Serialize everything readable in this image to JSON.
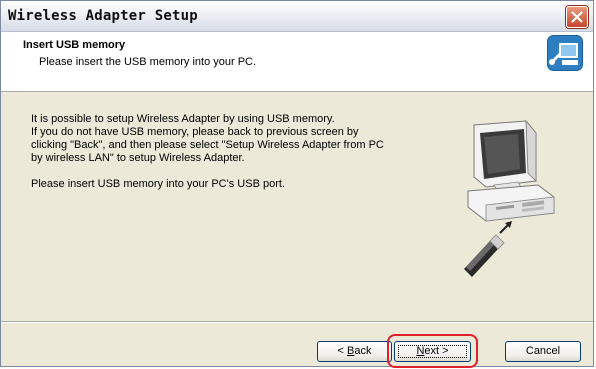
{
  "window": {
    "title": "Wireless Adapter Setup"
  },
  "header": {
    "title": "Insert USB memory",
    "subtitle": "Please insert the USB memory into your PC.",
    "icon": "computer-setup-icon"
  },
  "body": {
    "lines": [
      "It is possible to setup Wireless Adapter by using USB memory.",
      "If you do not have USB memory, please back to previous screen by",
      "clicking \"Back\", and then please select \"Setup Wireless Adapter from PC",
      "by wireless LAN\" to setup Wireless Adapter."
    ],
    "instruction": "Please insert USB memory into your PC's USB port."
  },
  "buttons": {
    "back_prefix": "< ",
    "back_mnemonic": "B",
    "back_rest": "ack",
    "next_mnemonic": "N",
    "next_rest": "ext >",
    "cancel": "Cancel"
  },
  "colors": {
    "highlight": "#e0202a",
    "close": "#c8462b"
  }
}
